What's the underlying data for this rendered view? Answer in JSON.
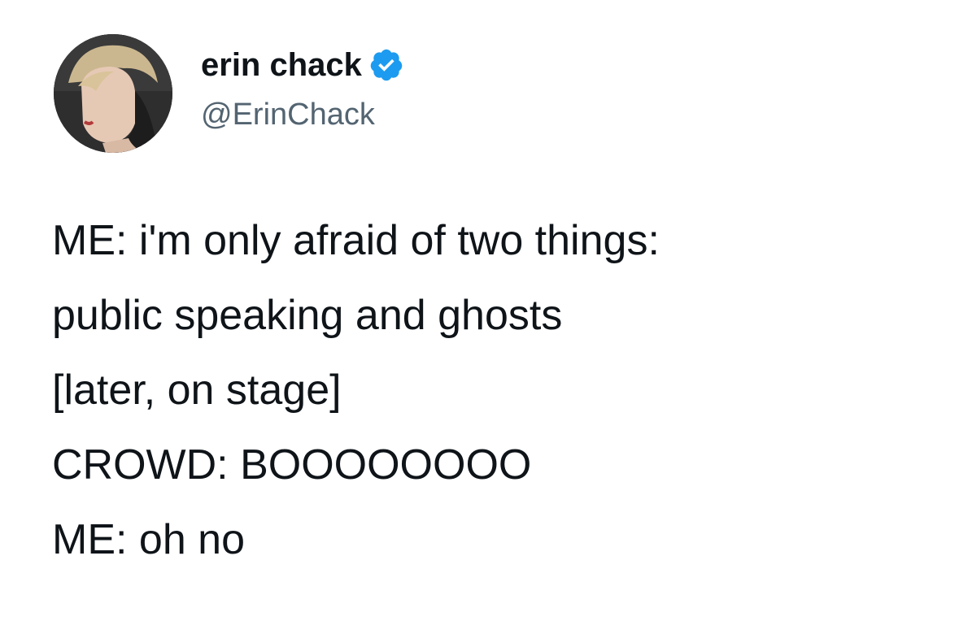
{
  "author": {
    "display_name": "erin chack",
    "handle": "@ErinChack",
    "verified": true,
    "avatar_icon": "profile-photo",
    "verified_icon": "verified-badge-icon"
  },
  "tweet": {
    "lines": [
      "ME: i'm only afraid of two things:",
      "public speaking and ghosts",
      "[later, on stage]",
      "CROWD: BOOOOOOOO",
      "ME: oh no"
    ]
  },
  "colors": {
    "text": "#0f1419",
    "handle": "#536471",
    "verified": "#1d9bf0"
  }
}
